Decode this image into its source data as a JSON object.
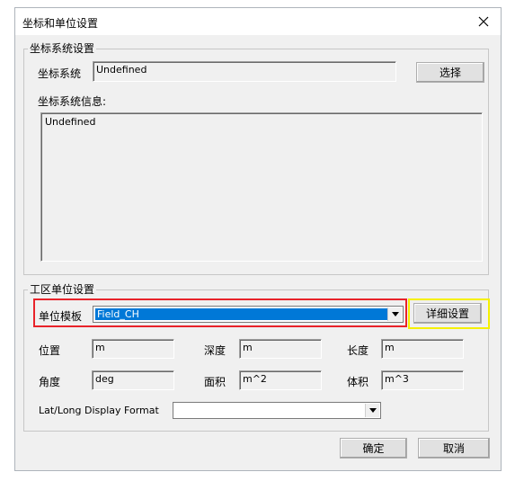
{
  "window": {
    "title": "坐标和单位设置",
    "close_glyph": "✕"
  },
  "coord_group": {
    "title": "坐标系统设置",
    "coord_label": "坐标系统",
    "coord_value": "Undefined",
    "select_button": "选择",
    "info_label": "坐标系统信息:",
    "info_value": "Undefined"
  },
  "unit_group": {
    "title": "工区单位设置",
    "template_label": "单位模板",
    "template_value": "Field_CH",
    "detail_button": "详细设置",
    "position_label": "位置",
    "position_value": "m",
    "depth_label": "深度",
    "depth_value": "m",
    "length_label": "长度",
    "length_value": "m",
    "angle_label": "角度",
    "angle_value": "deg",
    "area_label": "面积",
    "area_value": "m^2",
    "volume_label": "体积",
    "volume_value": "m^3",
    "latlong_label": "Lat/Long Display Format",
    "latlong_value": ""
  },
  "footer": {
    "ok_button": "确定",
    "cancel_button": "取消"
  },
  "highlight_colors": {
    "red": "#e8232a",
    "yellow": "#f5f000",
    "selection": "#0078d7"
  }
}
